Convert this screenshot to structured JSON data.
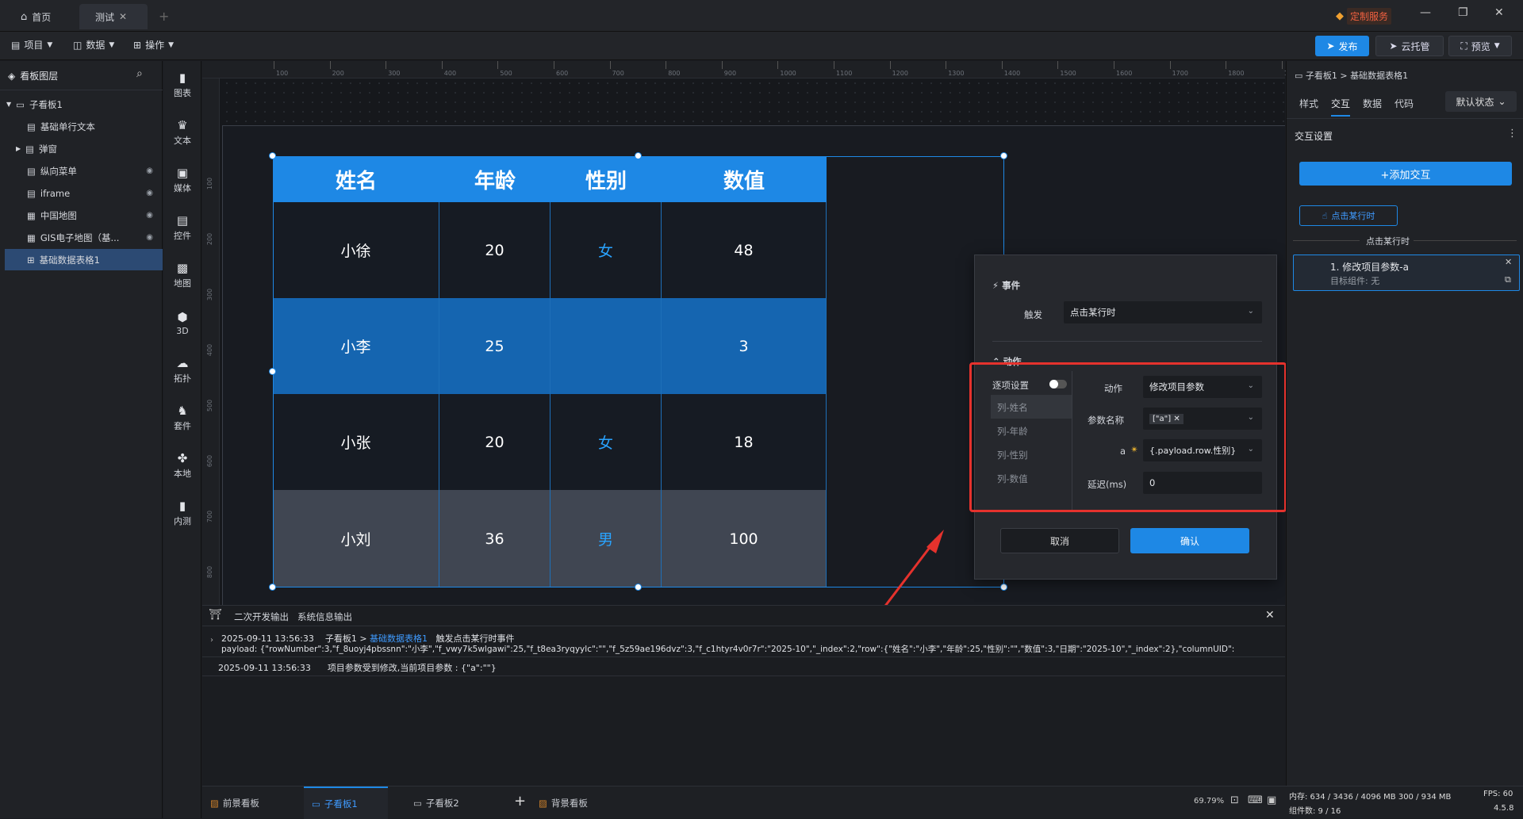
{
  "tabs": [
    {
      "label": "首页",
      "icon": "home-icon"
    },
    {
      "label": "测试",
      "icon": ""
    }
  ],
  "topright": {
    "service": "定制服务"
  },
  "menubar": {
    "project": "项目",
    "data": "数据",
    "operate": "操作"
  },
  "actions": {
    "publish": "发布",
    "cloud": "云托管",
    "preview": "预览"
  },
  "leftpanel": {
    "title": "看板图层",
    "items": [
      {
        "label": "子看板1"
      },
      {
        "label": "基础单行文本"
      },
      {
        "label": "弹窗"
      },
      {
        "label": "纵向菜单"
      },
      {
        "label": "iframe"
      },
      {
        "label": "中国地图"
      },
      {
        "label": "GIS电子地图（基..."
      },
      {
        "label": "基础数据表格1"
      }
    ]
  },
  "tools": [
    {
      "label": "图表",
      "icon": "chart-icon"
    },
    {
      "label": "文本",
      "icon": "text-icon"
    },
    {
      "label": "媒体",
      "icon": "media-icon"
    },
    {
      "label": "控件",
      "icon": "control-icon"
    },
    {
      "label": "地图",
      "icon": "map-icon"
    },
    {
      "label": "3D",
      "icon": "cube-icon"
    },
    {
      "label": "拓扑",
      "icon": "topology-icon"
    },
    {
      "label": "套件",
      "icon": "kit-icon"
    },
    {
      "label": "本地",
      "icon": "local-icon"
    },
    {
      "label": "内测",
      "icon": "beta-icon"
    }
  ],
  "ruler": {
    "ticks": [
      "100",
      "200",
      "300",
      "400",
      "500",
      "600",
      "700",
      "800",
      "900",
      "1000",
      "1100",
      "1200",
      "1300",
      "1400",
      "1500",
      "1600",
      "1700",
      "1800",
      "1900"
    ],
    "vticks": [
      "100",
      "200",
      "300",
      "400",
      "500",
      "600",
      "700",
      "800"
    ]
  },
  "table": {
    "headers": [
      "姓名",
      "年龄",
      "性别",
      "数值"
    ],
    "rows": [
      {
        "name": "小徐",
        "age": "20",
        "gender": "女",
        "value": "48",
        "bg": "#161b23"
      },
      {
        "name": "小李",
        "age": "25",
        "gender": "",
        "value": "3",
        "bg": "#1565b0"
      },
      {
        "name": "小张",
        "age": "20",
        "gender": "女",
        "value": "18",
        "bg": "#161b23"
      },
      {
        "name": "小刘",
        "age": "36",
        "gender": "男",
        "value": "100",
        "bg": "#404652"
      }
    ]
  },
  "dialog": {
    "event_title": "事件",
    "trigger_label": "触发",
    "trigger_value": "点击某行时",
    "action_title": "动作",
    "per_item": "逐项设置",
    "columns": [
      "列-姓名",
      "列-年龄",
      "列-性别",
      "列-数值"
    ],
    "action_label": "动作",
    "action_value": "修改项目参数",
    "param_label": "参数名称",
    "param_tag": "[\"a\"]",
    "a_label": "a",
    "a_value": "{.payload.row.性别}",
    "delay_label": "延迟(ms)",
    "delay_value": "0",
    "cancel": "取消",
    "confirm": "确认"
  },
  "console": {
    "tabs": [
      "二次开发输出",
      "系统信息输出"
    ],
    "line1_time": "2025-09-11 13:56:33",
    "line1_path": "子看板1 >",
    "line1_link": "基础数据表格1",
    "line1_text": "触发点击某行时事件",
    "line1_payload": "payload: {\"rowNumber\":3,\"f_8uoyj4pbssnn\":\"小李\",\"f_vwy7k5wlgawi\":25,\"f_t8ea3ryqyylc\":\"\",\"f_5z59ae196dvz\":3,\"f_c1htyr4v0r7r\":\"2025-10\",\"_index\":2,\"row\":{\"姓名\":\"小李\",\"年龄\":25,\"性别\":\"\",\"数值\":3,\"日期\":\"2025-10\",\"_index\":2},\"columnUID\":",
    "line2_time": "2025-09-11 13:56:33",
    "line2_text": "项目参数受到修改,当前项目参数 : {\"a\":\"\"}"
  },
  "bottom": {
    "tabs": [
      "前景看板",
      "子看板1",
      "子看板2",
      "背景看板"
    ],
    "zoom": "69.79%",
    "memory": "内存: 634 / 3436 / 4096 MB  300 / 934 MB",
    "fps": "FPS: 60",
    "components": "组件数: 9 / 16",
    "version": "4.5.8"
  },
  "rightpanel": {
    "breadcrumb": "子看板1 > 基础数据表格1",
    "tabs": [
      "样式",
      "交互",
      "数据",
      "代码"
    ],
    "state": "默认状态",
    "section": "交互设置",
    "add": "+添加交互",
    "event_chip": "点击某行时",
    "divider": "点击某行时",
    "card_title": "1. 修改项目参数-a",
    "card_sub": "目标组件: 无"
  },
  "colors": {
    "accent": "#1e88e5",
    "red": "#e5322d",
    "header": "#1e88e5"
  }
}
